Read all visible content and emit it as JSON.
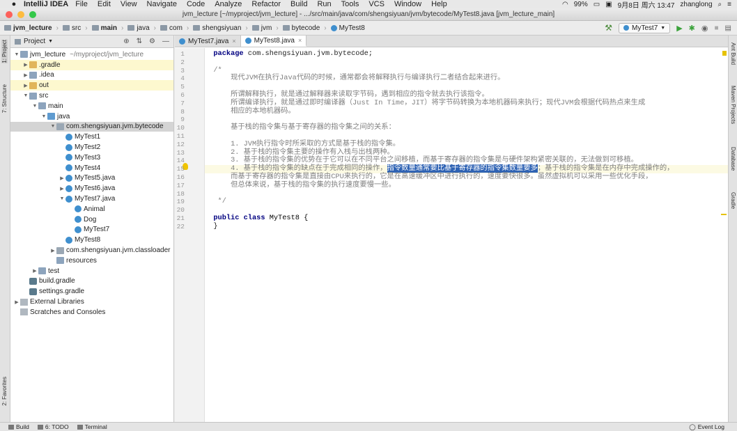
{
  "menubar": {
    "apple": "",
    "app": "IntelliJ IDEA",
    "items": [
      "File",
      "Edit",
      "View",
      "Navigate",
      "Code",
      "Analyze",
      "Refactor",
      "Build",
      "Run",
      "Tools",
      "VCS",
      "Window",
      "Help"
    ],
    "battery": "99%",
    "date": "9月8日 周六 13:47",
    "user": "zhanglong"
  },
  "window": {
    "title": "jvm_lecture [~/myproject/jvm_lecture] - .../src/main/java/com/shengsiyuan/jvm/bytecode/MyTest8.java [jvm_lecture_main]"
  },
  "breadcrumbs": [
    "jvm_lecture",
    "src",
    "main",
    "java",
    "com",
    "shengsiyuan",
    "jvm",
    "bytecode",
    "MyTest8"
  ],
  "toolbar": {
    "run_config": "MyTest7"
  },
  "left_tabs": [
    "1: Project",
    "7: Structure",
    "2: Favorites"
  ],
  "right_tabs": [
    "Ant Build",
    "Maven Projects",
    "Database",
    "Gradle"
  ],
  "project_panel": {
    "title": "Project",
    "tree": [
      {
        "label": "jvm_lecture",
        "extra": "~/myproject/jvm_lecture",
        "depth": 0,
        "arrow": "▼",
        "icon": "folder",
        "highlight": false
      },
      {
        "label": ".gradle",
        "extra": "",
        "depth": 1,
        "arrow": "▶",
        "icon": "ofolder",
        "highlight": true
      },
      {
        "label": ".idea",
        "extra": "",
        "depth": 1,
        "arrow": "▶",
        "icon": "folder",
        "highlight": false
      },
      {
        "label": "out",
        "extra": "",
        "depth": 1,
        "arrow": "▶",
        "icon": "ofolder",
        "highlight": true
      },
      {
        "label": "src",
        "extra": "",
        "depth": 1,
        "arrow": "▼",
        "icon": "folder",
        "highlight": false
      },
      {
        "label": "main",
        "extra": "",
        "depth": 2,
        "arrow": "▼",
        "icon": "folder",
        "highlight": false
      },
      {
        "label": "java",
        "extra": "",
        "depth": 3,
        "arrow": "▼",
        "icon": "src",
        "highlight": false
      },
      {
        "label": "com.shengsiyuan.jvm.bytecode",
        "extra": "",
        "depth": 4,
        "arrow": "▼",
        "icon": "pkg",
        "highlight": false,
        "selected": true
      },
      {
        "label": "MyTest1",
        "extra": "",
        "depth": 5,
        "arrow": "",
        "icon": "cls",
        "highlight": false
      },
      {
        "label": "MyTest2",
        "extra": "",
        "depth": 5,
        "arrow": "",
        "icon": "cls",
        "highlight": false
      },
      {
        "label": "MyTest3",
        "extra": "",
        "depth": 5,
        "arrow": "",
        "icon": "cls",
        "highlight": false
      },
      {
        "label": "MyTest4",
        "extra": "",
        "depth": 5,
        "arrow": "",
        "icon": "cls",
        "highlight": false
      },
      {
        "label": "MyTest5.java",
        "extra": "",
        "depth": 5,
        "arrow": "▶",
        "icon": "cls",
        "highlight": false
      },
      {
        "label": "MyTest6.java",
        "extra": "",
        "depth": 5,
        "arrow": "▶",
        "icon": "cls",
        "highlight": false
      },
      {
        "label": "MyTest7.java",
        "extra": "",
        "depth": 5,
        "arrow": "▼",
        "icon": "cls",
        "highlight": false
      },
      {
        "label": "Animal",
        "extra": "",
        "depth": 6,
        "arrow": "",
        "icon": "cls",
        "highlight": false
      },
      {
        "label": "Dog",
        "extra": "",
        "depth": 6,
        "arrow": "",
        "icon": "cls",
        "highlight": false
      },
      {
        "label": "MyTest7",
        "extra": "",
        "depth": 6,
        "arrow": "",
        "icon": "cls",
        "highlight": false
      },
      {
        "label": "MyTest8",
        "extra": "",
        "depth": 5,
        "arrow": "",
        "icon": "cls",
        "highlight": false
      },
      {
        "label": "com.shengsiyuan.jvm.classloader",
        "extra": "",
        "depth": 4,
        "arrow": "▶",
        "icon": "pkg",
        "highlight": false
      },
      {
        "label": "resources",
        "extra": "",
        "depth": 4,
        "arrow": "",
        "icon": "folder",
        "highlight": false
      },
      {
        "label": "test",
        "extra": "",
        "depth": 2,
        "arrow": "▶",
        "icon": "folder",
        "highlight": false
      },
      {
        "label": "build.gradle",
        "extra": "",
        "depth": 1,
        "arrow": "",
        "icon": "gradle",
        "highlight": false
      },
      {
        "label": "settings.gradle",
        "extra": "",
        "depth": 1,
        "arrow": "",
        "icon": "gradle",
        "highlight": false
      },
      {
        "label": "External Libraries",
        "extra": "",
        "depth": 0,
        "arrow": "▶",
        "icon": "lib",
        "highlight": false
      },
      {
        "label": "Scratches and Consoles",
        "extra": "",
        "depth": 0,
        "arrow": "",
        "icon": "lib",
        "highlight": false
      }
    ]
  },
  "editor": {
    "tabs": [
      {
        "label": "MyTest7.java",
        "active": false
      },
      {
        "label": "MyTest8.java",
        "active": true
      }
    ],
    "current_line": 15,
    "lines": [
      {
        "n": "1",
        "parts": [
          [
            "kw",
            "package"
          ],
          [
            "",
            "com.shengsiyuan.jvm.bytecode;"
          ]
        ]
      },
      {
        "n": "2",
        "parts": []
      },
      {
        "n": "3",
        "parts": [
          [
            "cm",
            "/*"
          ]
        ]
      },
      {
        "n": "4",
        "parts": [
          [
            "cm",
            "    现代JVM在执行Java代码的时候，通常都会将解释执行与编译执行二者结合起来进行。"
          ]
        ]
      },
      {
        "n": "5",
        "parts": []
      },
      {
        "n": "6",
        "parts": [
          [
            "cm",
            "    所谓解释执行，就是通过解释器来读取字节码，遇到相应的指令就去执行该指令。"
          ]
        ]
      },
      {
        "n": "7",
        "parts": [
          [
            "cm",
            "    所谓编译执行，就是通过即时编译器（Just In Time，JIT）将字节码转换为本地机器码来执行；现代JVM会根据代码热点来生成"
          ]
        ]
      },
      {
        "n": "8",
        "parts": [
          [
            "cm",
            "    相应的本地机器码。"
          ]
        ]
      },
      {
        "n": "9",
        "parts": []
      },
      {
        "n": "10",
        "parts": [
          [
            "cm",
            "    基于栈的指令集与基于寄存器的指令集之间的关系："
          ]
        ]
      },
      {
        "n": "11",
        "parts": []
      },
      {
        "n": "12",
        "parts": [
          [
            "cm",
            "    1. JVM执行指令时所采取的方式是基于栈的指令集。"
          ]
        ]
      },
      {
        "n": "13",
        "parts": [
          [
            "cm",
            "    2. 基于栈的指令集主要的操作有入栈与出栈两种。"
          ]
        ]
      },
      {
        "n": "14",
        "parts": [
          [
            "cm",
            "    3. 基于栈的指令集的优势在于它可以在不同平台之间移植，而基于寄存器的指令集是与硬件架构紧密关联的，无法做到可移植。"
          ]
        ]
      },
      {
        "n": "15",
        "parts": [
          [
            "cm",
            "    4. 基于栈的指令集的缺点在于完成相同的操作，"
          ],
          [
            "hl",
            "指令数量通常要比基于寄存器的指令集数量要多"
          ],
          [
            "cm",
            "；基于栈的指令集是在内存中完成操作的，"
          ]
        ]
      },
      {
        "n": "16",
        "parts": [
          [
            "cm",
            "    而基于寄存器的指令集是直接由CPU来执行的，它是在高速缓冲区中进行执行的，速度要快很多。虽然虚拟机可以采用一些优化手段，"
          ]
        ]
      },
      {
        "n": "17",
        "parts": [
          [
            "cm",
            "    但总体来说，基于栈的指令集的执行速度要慢一些。"
          ]
        ]
      },
      {
        "n": "18",
        "parts": []
      },
      {
        "n": "19",
        "parts": [
          [
            "cm",
            " */"
          ]
        ]
      },
      {
        "n": "20",
        "parts": []
      },
      {
        "n": "21",
        "parts": [
          [
            "kw",
            "public class"
          ],
          [
            "cls2",
            " MyTest8 {"
          ]
        ]
      },
      {
        "n": "22",
        "parts": [
          [
            "",
            "}"
          ]
        ]
      }
    ]
  },
  "status_bar": {
    "build": "Build",
    "todo": "6: TODO",
    "terminal": "Terminal",
    "event_log": "Event Log"
  },
  "colors": {
    "selection": "#2f63b4",
    "keyword": "#000080",
    "comment": "#7f7f7f",
    "current_line": "#fcfae3"
  }
}
